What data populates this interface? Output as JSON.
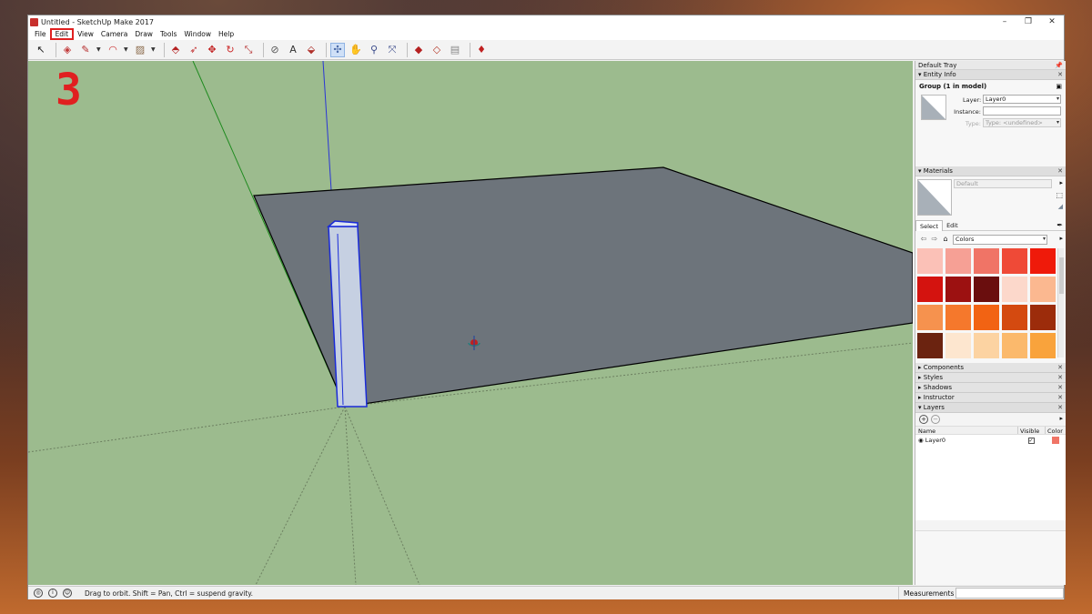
{
  "window": {
    "title": "Untitled - SketchUp Make 2017",
    "controls": [
      "–",
      "❐",
      "✕"
    ]
  },
  "menubar": {
    "items": [
      "File",
      "Edit",
      "View",
      "Camera",
      "Draw",
      "Tools",
      "Window",
      "Help"
    ],
    "highlighted": "Edit"
  },
  "annotation": {
    "step_number": "3",
    "color": "#e02020"
  },
  "toolbar": {
    "tools": [
      {
        "name": "select-tool-icon",
        "glyph": "↖"
      },
      {
        "name": "eraser-tool-icon",
        "glyph": "◈"
      },
      {
        "name": "line-tool-icon",
        "glyph": "✎"
      },
      {
        "name": "arc-tool-icon",
        "glyph": "◠"
      },
      {
        "name": "shape-tool-icon",
        "glyph": "▨"
      },
      {
        "name": "push-pull-tool-icon",
        "glyph": "⬘"
      },
      {
        "name": "follow-me-tool-icon",
        "glyph": "➶"
      },
      {
        "name": "move-tool-icon",
        "glyph": "✥"
      },
      {
        "name": "rotate-tool-icon",
        "glyph": "↻"
      },
      {
        "name": "scale-tool-icon",
        "glyph": "⤡"
      },
      {
        "name": "tape-measure-tool-icon",
        "glyph": "⊘"
      },
      {
        "name": "text-tool-icon",
        "glyph": "A"
      },
      {
        "name": "paint-bucket-tool-icon",
        "glyph": "⬙"
      },
      {
        "name": "orbit-tool-icon",
        "glyph": "✣"
      },
      {
        "name": "pan-tool-icon",
        "glyph": "✋"
      },
      {
        "name": "zoom-tool-icon",
        "glyph": "⚲"
      },
      {
        "name": "zoom-extents-tool-icon",
        "glyph": "⤧"
      },
      {
        "name": "3d-warehouse-icon",
        "glyph": "◆"
      },
      {
        "name": "extension-warehouse-icon",
        "glyph": "◇"
      },
      {
        "name": "layout-icon",
        "glyph": "▤"
      },
      {
        "name": "ruby-console-icon",
        "glyph": "♦"
      }
    ],
    "active_tool": "orbit-tool-icon"
  },
  "tray": {
    "title": "Default Tray",
    "entity_info": {
      "header": "Entity Info",
      "selection": "Group (1 in model)",
      "layer_label": "Layer:",
      "layer_value": "Layer0",
      "instance_label": "Instance:",
      "instance_value": "",
      "type_label": "Type:",
      "type_value": "Type: <undefined>"
    },
    "materials": {
      "header": "Materials",
      "name_value": "Default",
      "tabs": [
        "Select",
        "Edit"
      ],
      "library": "Colors",
      "swatches": [
        "#fbc1b7",
        "#f6a095",
        "#f07466",
        "#ef4a37",
        "#ef1a0a",
        "#d4130f",
        "#9c1111",
        "#6a0e0e",
        "#fcd8cb",
        "#fbb890",
        "#f6924e",
        "#f5782c",
        "#f26313",
        "#d44a10",
        "#9c2c0b",
        "#6b2310",
        "#fde6cf",
        "#fcd3a2",
        "#fbb96c",
        "#f9a33c"
      ]
    },
    "collapsed_panels": [
      "Components",
      "Styles",
      "Shadows",
      "Instructor"
    ],
    "layers": {
      "header": "Layers",
      "columns": [
        "Name",
        "Visible",
        "Color"
      ],
      "rows": [
        {
          "name": "Layer0",
          "visible": "✓",
          "color": "#f07466"
        }
      ]
    }
  },
  "statusbar": {
    "hint": "Drag to orbit. Shift = Pan, Ctrl = suspend gravity.",
    "measurements_label": "Measurements",
    "measurements_value": ""
  }
}
